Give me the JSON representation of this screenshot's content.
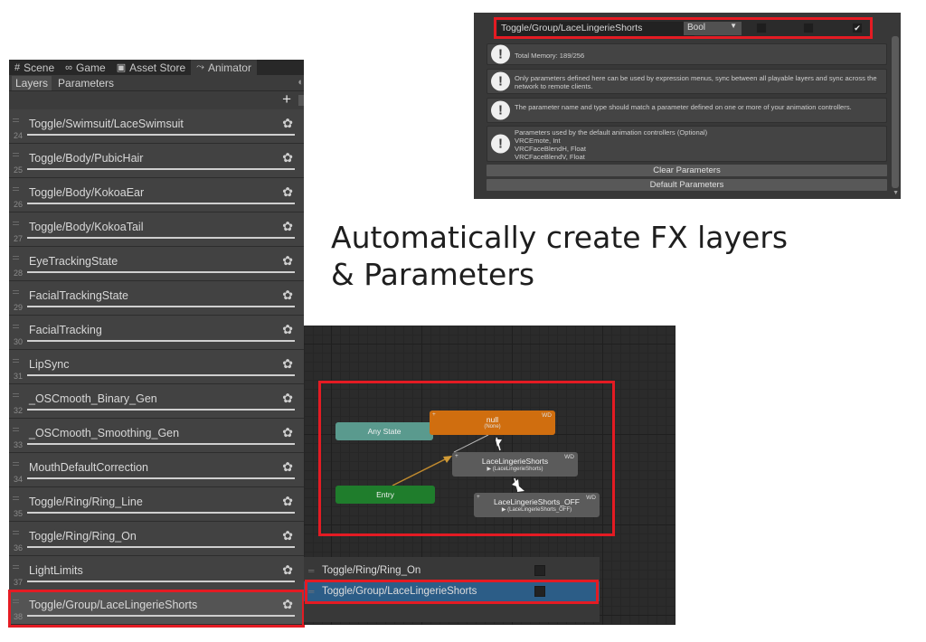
{
  "animator": {
    "tabs": [
      {
        "icon": "#",
        "label": "Scene"
      },
      {
        "icon": "∞",
        "label": "Game"
      },
      {
        "icon": "▣",
        "label": "Asset Store"
      },
      {
        "icon": "⤳",
        "label": "Animator"
      }
    ],
    "subtabs": [
      "Layers",
      "Parameters"
    ],
    "add_label": "+",
    "layers": [
      {
        "name": "Toggle/Swimsuit/LaceSwimsuit",
        "index": "24"
      },
      {
        "name": "Toggle/Body/PubicHair",
        "index": "25"
      },
      {
        "name": "Toggle/Body/KokoaEar",
        "index": "26"
      },
      {
        "name": "Toggle/Body/KokoaTail",
        "index": "27"
      },
      {
        "name": "EyeTrackingState",
        "index": "28"
      },
      {
        "name": "FacialTrackingState",
        "index": "29"
      },
      {
        "name": "FacialTracking",
        "index": "30"
      },
      {
        "name": "LipSync",
        "index": "31"
      },
      {
        "name": "_OSCmooth_Binary_Gen",
        "index": "32"
      },
      {
        "name": "_OSCmooth_Smoothing_Gen",
        "index": "33"
      },
      {
        "name": "MouthDefaultCorrection",
        "index": "34"
      },
      {
        "name": "Toggle/Ring/Ring_Line",
        "index": "35"
      },
      {
        "name": "Toggle/Ring/Ring_On",
        "index": "36"
      },
      {
        "name": "LightLimits",
        "index": "37"
      },
      {
        "name": "Toggle/Group/LaceLingerieShorts",
        "index": "38"
      }
    ],
    "gear_glyph": "✿"
  },
  "parameters_panel": {
    "param_name": "Toggle/Group/LaceLingerieShorts",
    "param_type": "Bool",
    "check_glyph": "✔",
    "infos": [
      "Total Memory: 189/256",
      "Only parameters defined here can be used by expression menus, sync between all playable layers and sync across the network to remote clients.",
      "The parameter name and type should match a parameter defined on one or more of your animation controllers.",
      "Parameters used by the default animation controllers (Optional)\nVRCEmote, Int\nVRCFaceBlendH, Float\nVRCFaceBlendV, Float"
    ],
    "buttons": [
      "Clear Parameters",
      "Default Parameters"
    ]
  },
  "caption": {
    "line1": "Automatically create FX layers",
    "line2": "& Parameters"
  },
  "state_machine": {
    "any_state": "Any State",
    "entry": "Entry",
    "null_state": {
      "title": "null",
      "sub": "(None)",
      "tag": "WD"
    },
    "lace_state": {
      "title": "LaceLingerieShorts",
      "sub": "▶ (LaceLingerieShorts)",
      "tag": "WD"
    },
    "lace_off_state": {
      "title": "LaceLingerieShorts_OFF",
      "sub": "▶ (LaceLingerieShorts_OFF)",
      "tag": "WD"
    }
  },
  "mini_list": [
    {
      "label": "Toggle/Ring/Ring_On"
    },
    {
      "label": "Toggle/Group/LaceLingerieShorts"
    }
  ],
  "colors": {
    "highlight_border": "#e41b23",
    "any_state": "#5a9a8e",
    "entry": "#1f7d2c",
    "default_state": "#d06e0f",
    "selected_row": "#2c5d87"
  }
}
